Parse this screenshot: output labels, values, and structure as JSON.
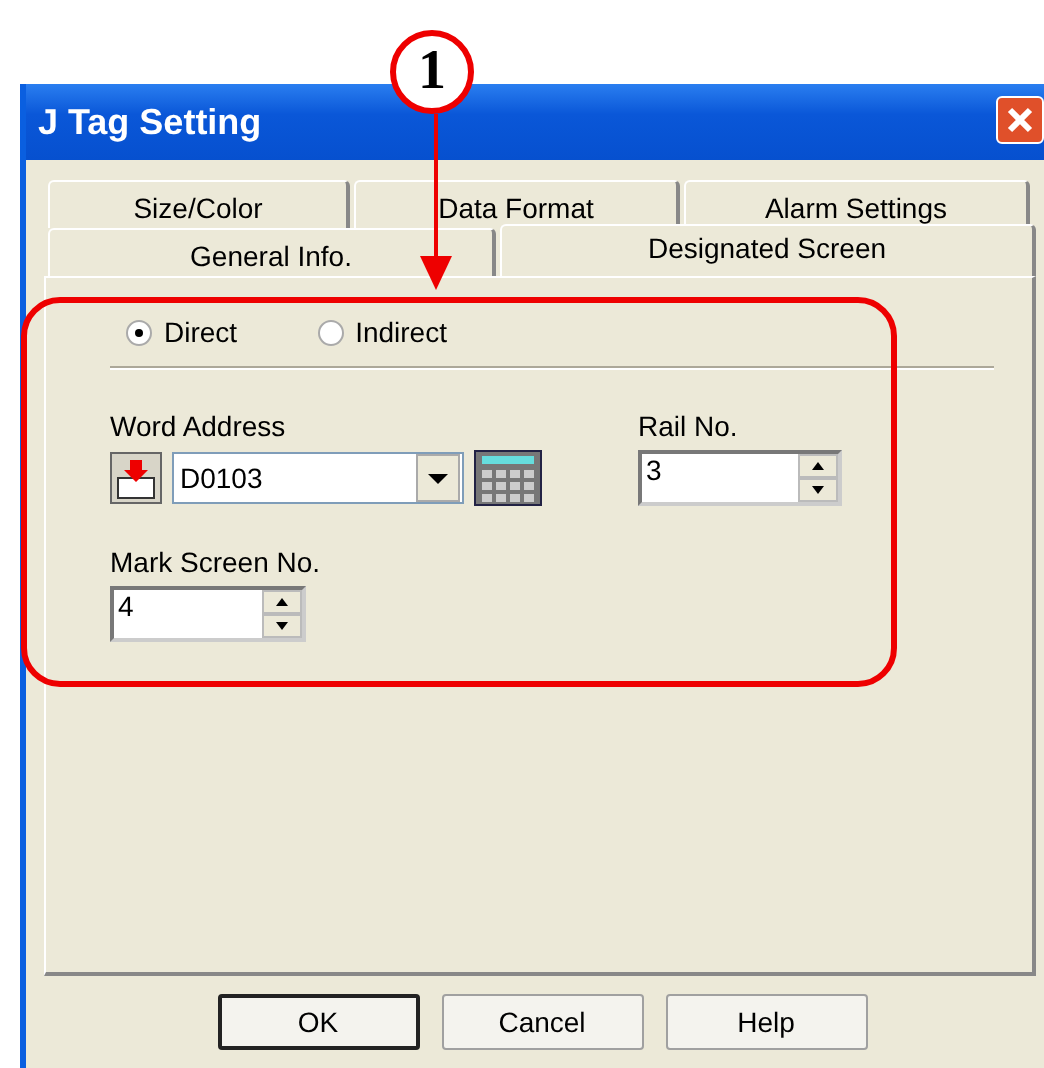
{
  "callout": {
    "number": "1"
  },
  "window": {
    "title": "J Tag Setting"
  },
  "tab_rows": [
    [
      {
        "label": "Size/Color",
        "selected": false
      },
      {
        "label": "Data Format",
        "selected": false
      },
      {
        "label": "Alarm Settings",
        "selected": false
      }
    ],
    [
      {
        "label": "General Info.",
        "selected": false
      },
      {
        "label": "Designated Screen",
        "selected": true
      }
    ]
  ],
  "mode_options": [
    {
      "label": "Direct",
      "selected": true
    },
    {
      "label": "Indirect",
      "selected": false
    }
  ],
  "word_address": {
    "label": "Word Address",
    "value": "D0103"
  },
  "rail_no": {
    "label": "Rail No.",
    "value": "3"
  },
  "mark_screen_no": {
    "label": "Mark Screen No.",
    "value": "4"
  },
  "buttons": [
    {
      "label": "OK",
      "default": true
    },
    {
      "label": "Cancel",
      "default": false
    },
    {
      "label": "Help",
      "default": false
    }
  ]
}
